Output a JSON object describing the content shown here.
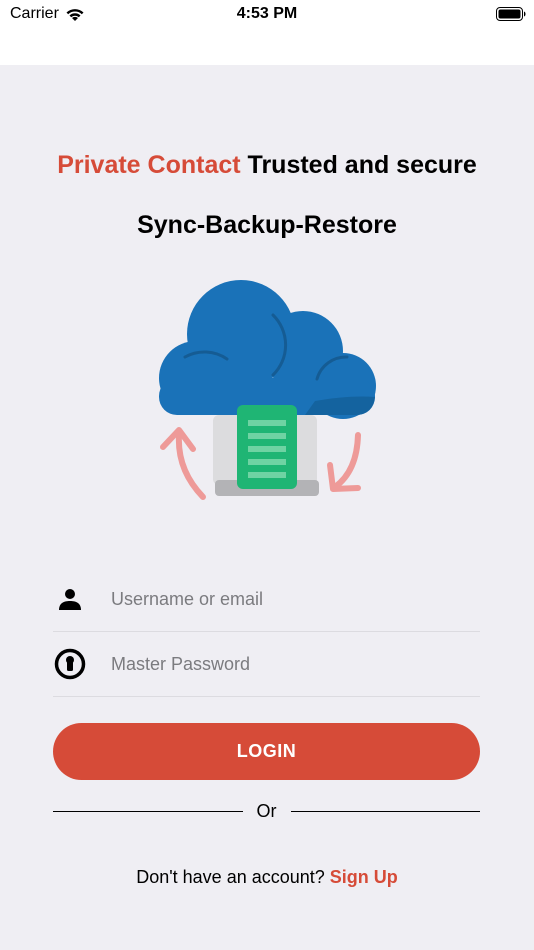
{
  "status_bar": {
    "carrier": "Carrier",
    "time": "4:53 PM"
  },
  "header": {
    "brand": "Private Contact",
    "tagline": "Trusted and secure",
    "subtitle": "Sync-Backup-Restore"
  },
  "form": {
    "username_placeholder": "Username or email",
    "username_value": "",
    "password_placeholder": "Master Password",
    "password_value": "",
    "login_label": "LOGIN"
  },
  "divider": {
    "or_label": "Or"
  },
  "signup": {
    "prompt": "Don't have an account?",
    "link_label": "Sign Up"
  },
  "icons": {
    "username": "person-icon",
    "password": "keyhole-icon",
    "wifi": "wifi-icon",
    "battery": "battery-icon",
    "illustration": "cloud-sync-illustration"
  },
  "colors": {
    "accent": "#d64b38",
    "background": "#efeef3",
    "cloud": "#1a72b8",
    "document": "#1fb574",
    "sync_arrows": "#ee9a98"
  }
}
